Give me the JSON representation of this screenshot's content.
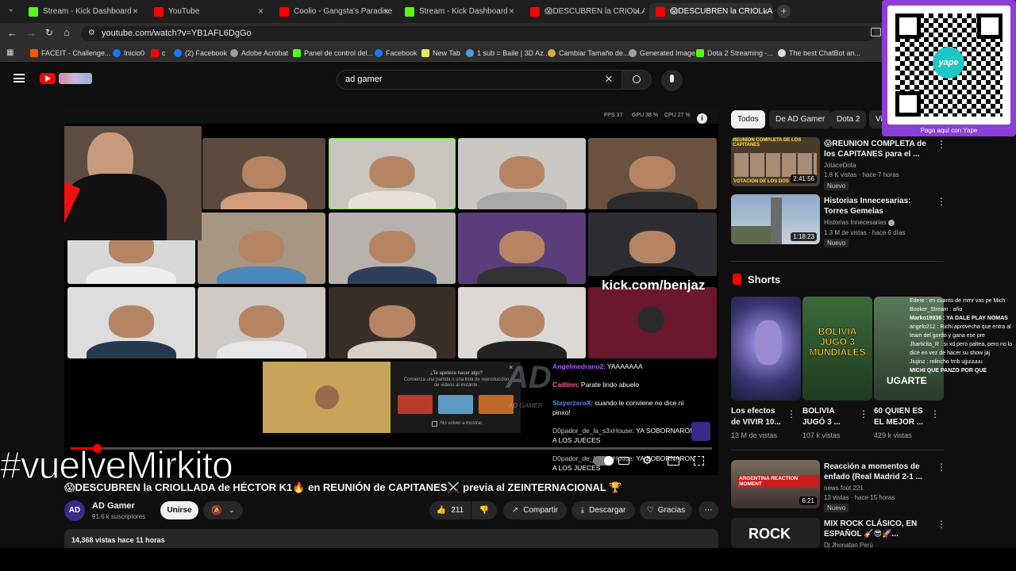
{
  "tabs": [
    {
      "label": "Stream - Kick Dashboard",
      "icon": "kick-icon"
    },
    {
      "label": "YouTube",
      "icon": "youtube-icon"
    },
    {
      "label": "Coolio - Gangsta's Paradise (fe",
      "icon": "youtube-icon"
    },
    {
      "label": "Stream - Kick Dashboard",
      "icon": "kick-icon"
    },
    {
      "label": "😱DESCUBREN la CRIOLLADA",
      "icon": "youtube-icon"
    },
    {
      "label": "😱DESCUBREN la CRIOLLA",
      "icon": "youtube-icon"
    }
  ],
  "address": {
    "url": "youtube.com/watch?v=YB1AFL6DgGo"
  },
  "bookmarks": [
    "FACEIT - Challenge...",
    "Inicio0",
    "c",
    "(2) Facebook",
    "Adobe Acrobat",
    "Panel de control del...",
    "Facebook",
    "New Tab",
    "1 sub = Baile | 3D Az...",
    "Cambiar Tamaño de...",
    "Generated Image",
    "Dota 2 Streaming -...",
    "The best ChatBot an..."
  ],
  "header": {
    "search_value": "ad gamer"
  },
  "player": {
    "stats": {
      "fps": "FPS 37",
      "gpu": "GPU 38 %",
      "cpu": "CPU 27 %"
    },
    "kick_banner": "kick.com/benjaz",
    "popup": {
      "title": "¿Te apetece hacer algo?",
      "body": "Comienza una partida o una lista de reproducción de videos al instante.",
      "checkbox": "No volver a mostrar."
    },
    "chat": [
      {
        "user": "Angelmedrano2",
        "msg": "YAAAAAAA"
      },
      {
        "user": "Caitlinn",
        "msg": "Parate lindo abuelo"
      },
      {
        "user": "SlayerzeroX",
        "msg": "cuando le conviene no dice ni pinxo!"
      },
      {
        "user": "D0pador_de_la_s3xHouse",
        "msg": "YA SOBORNARON A LOS JUECES"
      },
      {
        "user": "D0pador_de_la_s3xHouse",
        "msg": "YA SOBORNARON A LOS JUECES"
      }
    ],
    "ad_logo_text": "AD GAMER"
  },
  "overlay": {
    "hashtag": "#vuelveMirkito"
  },
  "video": {
    "title": "😱DESCUBREN la CRIOLLADA de HÉCTOR K1🔥 en REUNIÓN de CAPITANES⚔️ previa al ZEINTERNACIONAL 🏆",
    "channel": "AD Gamer",
    "subscribers": "91.6 k suscriptores",
    "join_label": "Unirse",
    "likes": "211",
    "share_label": "Compartir",
    "download_label": "Descargar",
    "thanks_label": "Gracias",
    "views": "14,368 vistas",
    "age": "hace 11 horas"
  },
  "chips": [
    "Todos",
    "De AD Gamer",
    "Dota 2",
    "Vi"
  ],
  "related": [
    {
      "title": "😱REUNION COMPLETA de los CAPITANES para el ...",
      "channel": "JotaceDota",
      "meta": "1.8 K vistas · hace 7 horas",
      "duration": "2:41:56",
      "badge": "Nuevo",
      "thumb_text": "REUNION COMPLETA DE LOS CAPITANES",
      "thumb_text2": "VOTACION DE LOS DOS"
    },
    {
      "title": "Historias Innecesarias: Torres Gemelas",
      "channel": "Historias Innecesarias",
      "meta": "1.3 M de vistas · hace 6 días",
      "duration": "1:18:23",
      "badge": "Nuevo"
    },
    {
      "title": "Reacción a momentos de enfado (Real Madrid 2-1 ...",
      "channel": "news foot 221",
      "meta": "13 vistas · hace 15 horas",
      "duration": "6:21",
      "badge": "Nuevo",
      "thumb_text": "ARGENTINA REACTION MOMENT"
    },
    {
      "title": "MIX ROCK CLÁSICO, EN ESPAÑOL 🎸😎🚀...",
      "channel": "Dj Jhonatan Perú",
      "thumb_text": "ROCK"
    }
  ],
  "shorts": {
    "heading": "Shorts",
    "items": [
      {
        "title": "Los efectos de VIVIR 10...",
        "views": "13 M de vistas"
      },
      {
        "title": "BOLIVIA JUGÓ 3 ...",
        "views": "107 k vistas",
        "thumb_text": "BOLIVIA JUGÓ 3 MUNDIALES"
      },
      {
        "title": "60 QUIEN ES EL MEJOR ...",
        "views": "429 k vistas",
        "thumb_text": "UGARTE"
      }
    ]
  },
  "stream_chat": [
    "Edere : en cuanto de mmr vas pe Mich",
    "Booker_Stream : año",
    "Marko19936 : YA DALE PLAY NOMAS",
    "angelo212 : Richi aprovecha que entra al team del gordo y gana ese pre",
    "Jharticita_R : si xd pero paltea, pero no lo dice en vez de hacer su show jaj",
    "Jiujinz : relincho tmb ujjuuuuu",
    "MICHI QUE PANZO POR QUE"
  ],
  "qr": {
    "caption": "Paga aquí con Yape",
    "brand": "yape"
  },
  "colors": {
    "youtube_red": "#ff0000",
    "kick_green": "#53fc18",
    "yape_purple": "#8b3fd6"
  }
}
